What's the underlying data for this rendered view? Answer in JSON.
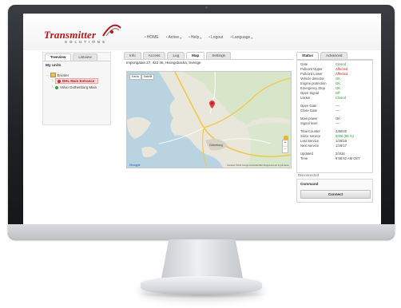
{
  "app": {
    "logo_name": "Transmitter",
    "logo_sub": "SOLUTIONS"
  },
  "nav": {
    "items": [
      {
        "label": "HOME"
      },
      {
        "label": "Active"
      },
      {
        "label": "Help"
      },
      {
        "label": "Logout"
      },
      {
        "label": "Language"
      }
    ]
  },
  "left": {
    "tabs": [
      "Treeview",
      "Listview"
    ],
    "title": "My units",
    "tree": {
      "root": "Ericsler",
      "items": [
        {
          "label": "DHL Main Entrance",
          "selected": true,
          "color": "#d22a2a"
        },
        {
          "label": "Volvo Gothenburg Main",
          "selected": false,
          "color": "#3aa03a"
        }
      ]
    }
  },
  "center": {
    "tabs": [
      "Info",
      "Access",
      "Log",
      "Map",
      "Settings"
    ],
    "active_tab": "Map",
    "address": "Importgatan 27, 422 46, Hisingsbacka, Sverige",
    "map": {
      "type_buttons": [
        "Karta",
        "Satellit"
      ],
      "zoom_in": "+",
      "zoom_out": "−",
      "google": "Google",
      "attribution": "Kartdata ©2016 Google   Användarvillkor   Rapportera ett fel på kartan",
      "city": "Göteborg"
    }
  },
  "right": {
    "tabs": [
      "Status",
      "Advanced"
    ],
    "status_rows": [
      {
        "key": "Gate",
        "value": "Closed",
        "state": "ok"
      },
      {
        "key": "Pullcord Upper",
        "value": "Affected",
        "state": "bad"
      },
      {
        "key": "Pullcord Lower",
        "value": "Affected",
        "state": "bad"
      },
      {
        "key": "Vehicle detector",
        "value": "OK",
        "state": "ok"
      },
      {
        "key": "Engine protection",
        "value": "OK",
        "state": "ok"
      },
      {
        "key": "Emergency Stop",
        "value": "OK",
        "state": "ok"
      },
      {
        "key": "Open Signal",
        "value": "Off",
        "state": "ok"
      },
      {
        "key": "Locker",
        "value": "Closed",
        "state": "ok"
      },
      {
        "key": "Open Gate",
        "value": "----",
        "state": "neutral"
      },
      {
        "key": "Close Gate",
        "value": "----",
        "state": "neutral"
      },
      {
        "key": "Main power",
        "value": "OK",
        "state": "neutral"
      },
      {
        "key": "Signal level",
        "value": "----",
        "state": "neutral"
      },
      {
        "key": "Total Counter",
        "value": "235026",
        "state": "neutral"
      },
      {
        "key": "Since service",
        "value": "5006 (98 %)",
        "state": "ok"
      },
      {
        "key": "Last Service",
        "value": "1/26/16",
        "state": "neutral"
      },
      {
        "key": "Next service",
        "value": "1/26/17",
        "state": "neutral"
      },
      {
        "key": "Updated",
        "value": "2/4/16",
        "state": "neutral"
      },
      {
        "key": "Time",
        "value": "9:58:52 AM CET",
        "state": "neutral"
      }
    ],
    "disconnected": "Disconnected",
    "command_title": "Command",
    "connect_label": "Connect"
  },
  "colors": {
    "brand": "#b3161b",
    "ok": "#2c9a2c",
    "bad": "#c41e1e"
  }
}
